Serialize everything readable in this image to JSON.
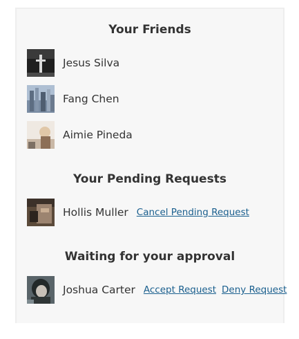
{
  "friends": {
    "heading": "Your Friends",
    "items": [
      {
        "name": "Jesus Silva"
      },
      {
        "name": "Fang Chen"
      },
      {
        "name": "Aimie Pineda"
      }
    ]
  },
  "pending": {
    "heading": "Your Pending Requests",
    "items": [
      {
        "name": "Hollis Muller",
        "action": "Cancel Pending Request"
      }
    ]
  },
  "approval": {
    "heading": "Waiting for your approval",
    "items": [
      {
        "name": "Joshua Carter",
        "accept": "Accept Request",
        "deny": "Deny Request"
      }
    ]
  },
  "colors": {
    "link": "#1a5f8e",
    "panel_bg": "#f7f7f7",
    "text": "#333333"
  }
}
